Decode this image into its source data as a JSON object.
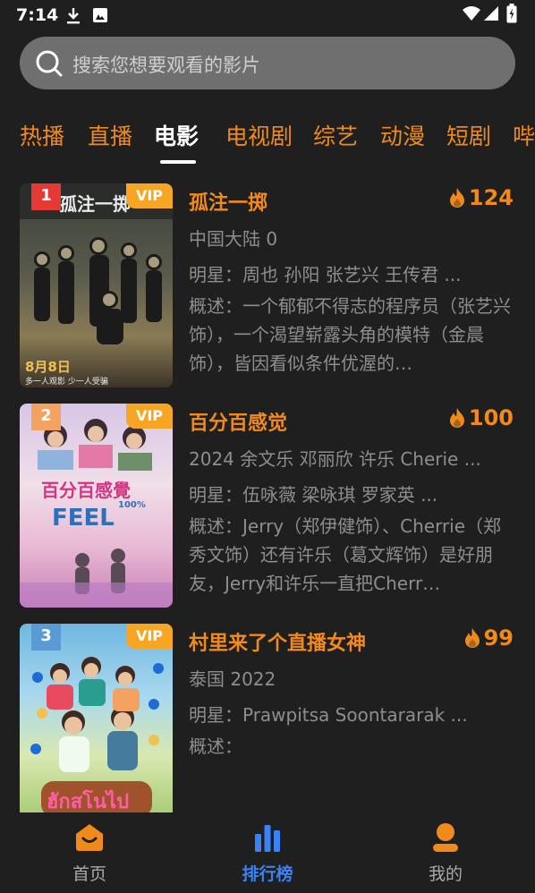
{
  "status_bar": {
    "time": "7:14",
    "icons": [
      "download-icon",
      "photos-icon",
      "wifi-icon",
      "signal-icon",
      "battery-icon"
    ]
  },
  "search": {
    "placeholder": "搜索您想要观看的影片"
  },
  "tabs": [
    {
      "label": "热播",
      "active": false
    },
    {
      "label": "直播",
      "active": false
    },
    {
      "label": "电影",
      "active": true
    },
    {
      "label": "电视剧",
      "active": false
    },
    {
      "label": "综艺",
      "active": false
    },
    {
      "label": "动漫",
      "active": false
    },
    {
      "label": "短剧",
      "active": false
    },
    {
      "label": "哔",
      "active": false
    }
  ],
  "movies": [
    {
      "rank": "1",
      "badge": "VIP",
      "title": "孤注一掷",
      "heat": "124",
      "meta": "中国大陆 0",
      "cast": "明星：周也 孙阳 张艺兴 王传君 ...",
      "desc": "概述：一个郁郁不得志的程序员（张艺兴 饰），一个渴望崭露头角的模特（金晨 饰），皆因看似条件优渥的…",
      "poster_text": [
        "孤注一掷",
        "8月8日",
        "多一人观影 少一人受骗"
      ],
      "rank_color": "#e53935"
    },
    {
      "rank": "2",
      "badge": "VIP",
      "title": "百分百感觉",
      "heat": "100",
      "meta": "2024 余文乐 邓丽欣 许乐 Cherie ...",
      "cast": "明星：伍咏薇 梁咏琪 罗家英 ...",
      "desc": "概述：Jerry（郑伊健饰）、Cherrie（郑秀文饰）还有许乐（葛文辉饰）是好朋友，Jerry和许乐一直把Cherr…",
      "poster_text": [
        "百分百感覺",
        "FEEL",
        "100%"
      ],
      "rank_color": "#f4a261"
    },
    {
      "rank": "3",
      "badge": "VIP",
      "title": "村里来了个直播女神",
      "heat": "99",
      "meta": "泰国 2022",
      "cast": "明星：Prawpitsa Soontararak ...",
      "desc": "概述：",
      "poster_text": [
        "ฮักสโนไป"
      ],
      "rank_color": "#5b9bd5"
    }
  ],
  "bottom_nav": [
    {
      "label": "首页",
      "icon": "home-icon",
      "active": false
    },
    {
      "label": "排行榜",
      "icon": "chart-bar-icon",
      "active": true
    },
    {
      "label": "我的",
      "icon": "profile-icon",
      "active": false
    }
  ],
  "colors": {
    "accent": "#f08a1c",
    "nav_active": "#3b82f6",
    "background": "#1f1f1f",
    "search_bg": "#6f6f6f"
  }
}
